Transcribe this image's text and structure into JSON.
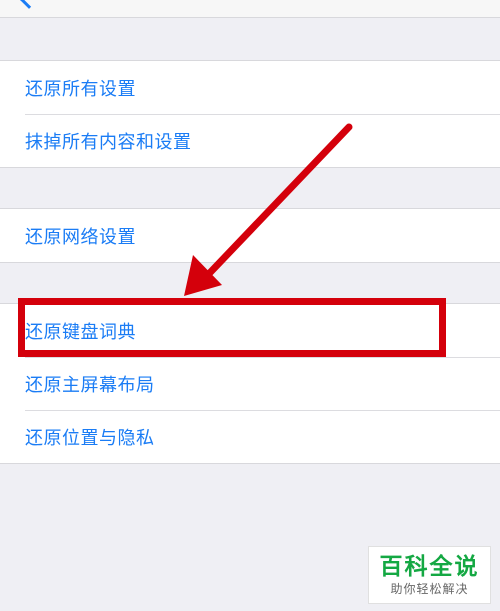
{
  "colors": {
    "accent": "#1a7cf5",
    "highlight": "#d4000b",
    "background": "#efeff4",
    "watermark_green": "#14a843"
  },
  "groups": [
    {
      "items": [
        {
          "label": "还原所有设置"
        },
        {
          "label": "抹掉所有内容和设置"
        }
      ]
    },
    {
      "items": [
        {
          "label": "还原网络设置"
        }
      ]
    },
    {
      "items": [
        {
          "label": "还原键盘词典"
        },
        {
          "label": "还原主屏幕布局"
        },
        {
          "label": "还原位置与隐私"
        }
      ]
    }
  ],
  "watermark": {
    "title": "百科全说",
    "subtitle": "助你轻松解决"
  }
}
